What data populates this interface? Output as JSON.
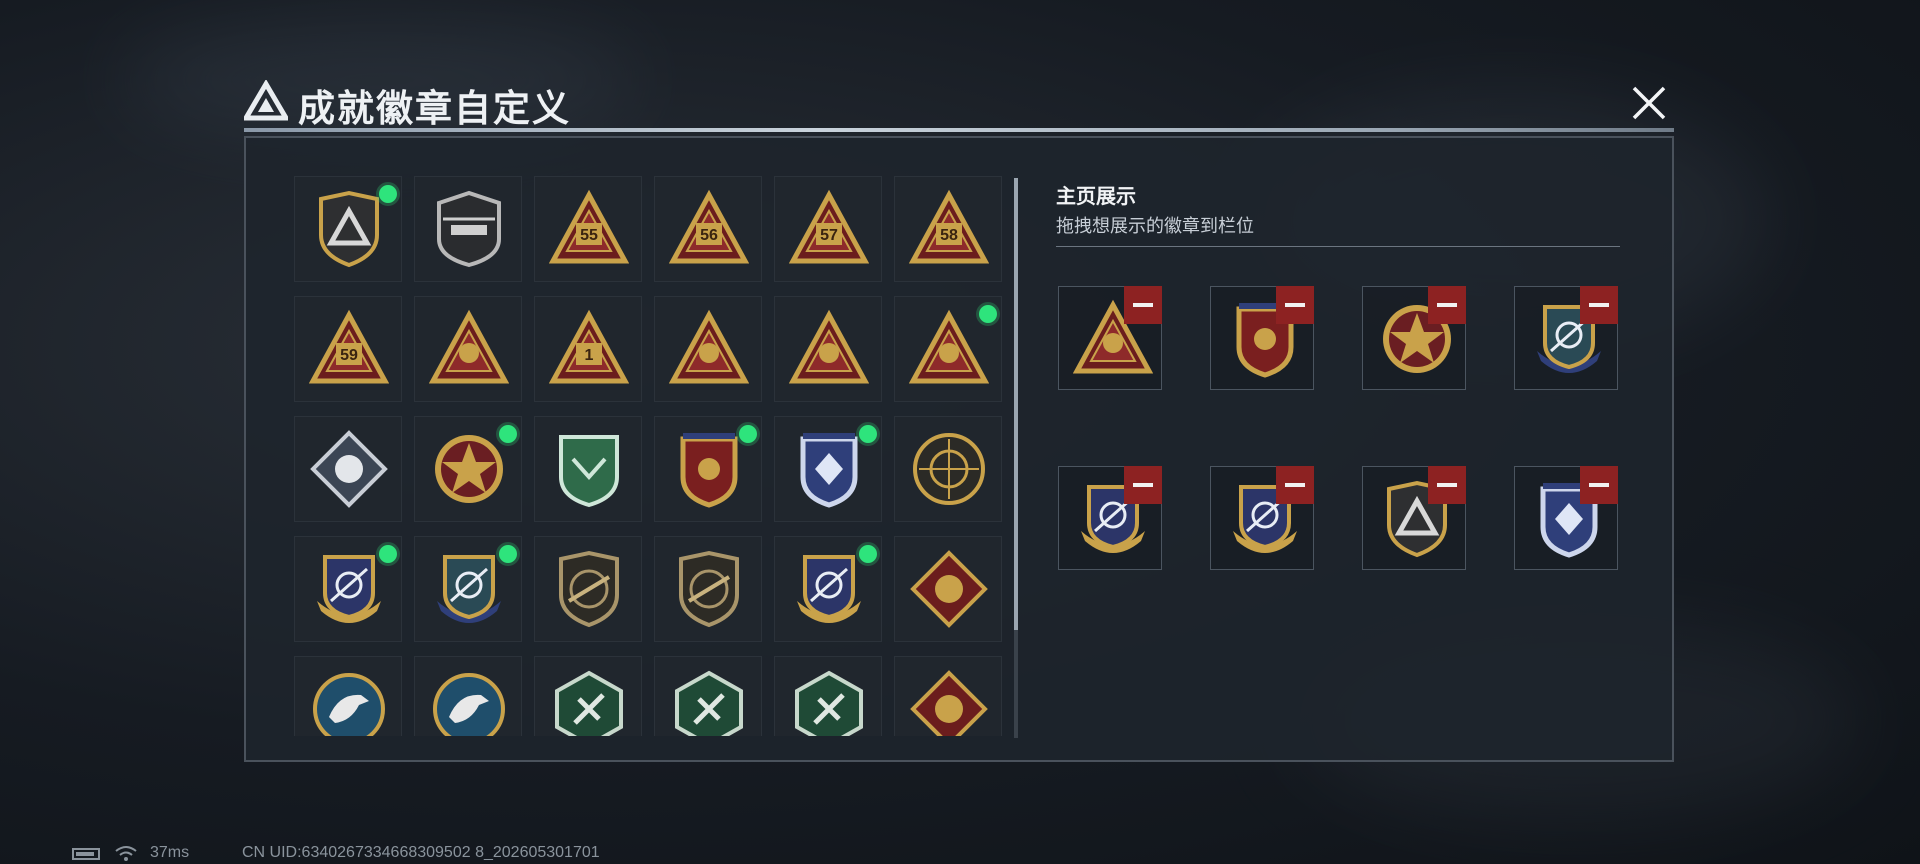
{
  "title": "成就徽章自定义",
  "display": {
    "title": "主页展示",
    "subtitle": "拖拽想展示的徽章到栏位"
  },
  "status": {
    "ping": "37ms",
    "uid": "CN UID:6340267334668309502 8_202605301701"
  },
  "colors": {
    "gold": "#c9a24a",
    "red": "#7a1f1f",
    "blue": "#2f3f7a",
    "green": "#2f6b4a",
    "teal": "#1f4e6b",
    "new_dot": "#2ee47c",
    "remove": "#8d2222"
  },
  "collection": [
    {
      "icon": "shield-tri",
      "label": "",
      "new": true
    },
    {
      "icon": "helicopter",
      "label": "",
      "new": false
    },
    {
      "icon": "tri-55",
      "label": "55",
      "new": false
    },
    {
      "icon": "tri-56",
      "label": "56",
      "new": false
    },
    {
      "icon": "tri-57",
      "label": "57",
      "new": false
    },
    {
      "icon": "tri-58",
      "label": "58",
      "new": false
    },
    {
      "icon": "tri-59",
      "label": "59",
      "new": false
    },
    {
      "icon": "tri-boat",
      "label": "",
      "new": false
    },
    {
      "icon": "tri-1",
      "label": "1",
      "new": false
    },
    {
      "icon": "tri-hands",
      "label": "",
      "new": false
    },
    {
      "icon": "tri-soldiers",
      "label": "",
      "new": false
    },
    {
      "icon": "tri-rocket",
      "label": "",
      "new": true
    },
    {
      "icon": "diamond-fist",
      "label": "",
      "new": false
    },
    {
      "icon": "star-red",
      "label": "",
      "new": true
    },
    {
      "icon": "shield-green",
      "label": "",
      "new": false
    },
    {
      "icon": "shield-red-gold",
      "label": "",
      "new": true
    },
    {
      "icon": "shield-blue-gem",
      "label": "",
      "new": true
    },
    {
      "icon": "circle-target",
      "label": "",
      "new": false
    },
    {
      "icon": "crest-gold",
      "label": "",
      "new": true
    },
    {
      "icon": "crest-blue",
      "label": "",
      "new": true
    },
    {
      "icon": "shield-rifle",
      "label": "",
      "new": false
    },
    {
      "icon": "shield-rifle",
      "label": "",
      "new": false
    },
    {
      "icon": "crest-gold",
      "label": "",
      "new": true
    },
    {
      "icon": "diamond-wolf",
      "label": "",
      "new": false
    },
    {
      "icon": "circle-eagle",
      "label": "",
      "new": false
    },
    {
      "icon": "circle-eagle",
      "label": "",
      "new": false
    },
    {
      "icon": "hex-bug",
      "label": "",
      "new": false
    },
    {
      "icon": "hex-bug",
      "label": "",
      "new": false
    },
    {
      "icon": "hex-hammer",
      "label": "",
      "new": false
    },
    {
      "icon": "diamond-dragon",
      "label": "",
      "new": false
    }
  ],
  "slots": [
    {
      "icon": "tri-rocket"
    },
    {
      "icon": "shield-red-gold"
    },
    {
      "icon": "star-red"
    },
    {
      "icon": "crest-blue"
    },
    {
      "icon": "crest-gold"
    },
    {
      "icon": "crest-gold"
    },
    {
      "icon": "shield-tri"
    },
    {
      "icon": "shield-blue-gem"
    }
  ]
}
